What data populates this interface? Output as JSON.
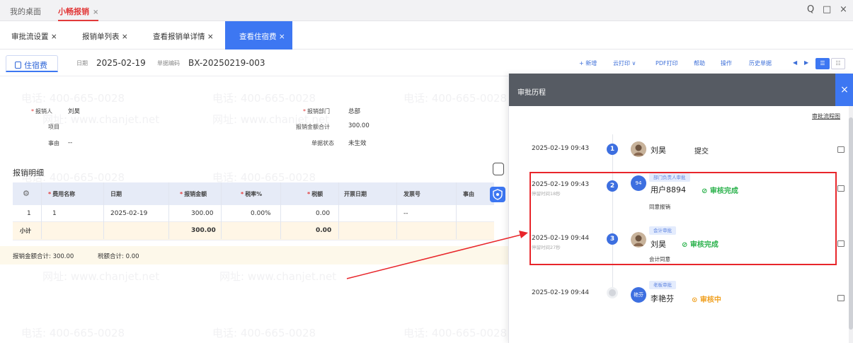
{
  "topbar": {
    "tabs": [
      {
        "label": "我的桌面"
      },
      {
        "label": "小畅报销",
        "close": "×"
      }
    ],
    "controls": {
      "search": "Q",
      "restore": "□",
      "close": "×"
    }
  },
  "subtabs": [
    {
      "label": "审批流设置",
      "close": "×"
    },
    {
      "label": "报销单列表",
      "close": "×"
    },
    {
      "label": "查看报销单详情",
      "close": "×"
    },
    {
      "label": "查看住宿费",
      "close": "×"
    }
  ],
  "doc": {
    "title": "住宿费",
    "date_label": "日期",
    "date": "2025-02-19",
    "number_label": "单据编码",
    "number": "BX-20250219-003"
  },
  "toolbar": [
    {
      "label": "+ 新增"
    },
    {
      "label": "云打印 ∨"
    },
    {
      "label": "PDF打印"
    },
    {
      "label": "帮助"
    },
    {
      "label": "操作"
    },
    {
      "label": "历史单据"
    }
  ],
  "form": {
    "applicant_label": "报销人",
    "applicant": "刘昊",
    "project_label": "项目",
    "reason_label": "事由",
    "reason": "--",
    "dept_label": "报销部门",
    "dept": "总部",
    "total_label": "报销金额合计",
    "total": "300.00",
    "status_label": "单据状态",
    "status": "未生效"
  },
  "details": {
    "section_title": "报销明细",
    "headers": [
      "费用名称",
      "日期",
      "报销金额",
      "税率%",
      "税额",
      "开票日期",
      "发票号",
      "事由"
    ],
    "rows": [
      {
        "no": "1",
        "name": "1",
        "date": "2025-02-19",
        "amount": "300.00",
        "rate": "0.00%",
        "tax": "0.00",
        "invoice_date": "",
        "invoice_no": "--",
        "reason": ""
      }
    ],
    "subtotal_label": "小计",
    "subtotal_amount": "300.00",
    "subtotal_tax": "0.00"
  },
  "footer": {
    "amount_label": "报销金额合计:",
    "amount": "300.00",
    "tax_label": "税额合计:",
    "tax": "0.00"
  },
  "panel": {
    "title": "审批历程",
    "close": "×",
    "link": "审批流程图",
    "entries": [
      {
        "step": "1",
        "time": "2025-02-19 09:43",
        "sub": "",
        "avatar": "photo",
        "badge": "",
        "name": "刘昊",
        "action": "提交",
        "status": "",
        "comment": ""
      },
      {
        "step": "2",
        "time": "2025-02-19 09:43",
        "sub": "停留时间18秒",
        "avatar": "94",
        "badge": "部门负责人审批",
        "name": "用户8894",
        "action": "",
        "status": "⊘ 审核完成",
        "comment": "同意报销"
      },
      {
        "step": "3",
        "time": "2025-02-19 09:44",
        "sub": "停留时间27秒",
        "avatar": "photo",
        "badge": "会计审批",
        "name": "刘昊",
        "action": "",
        "status": "⊘ 审核完成",
        "comment": "会计同意"
      },
      {
        "step": "",
        "time": "2025-02-19 09:44",
        "sub": "",
        "avatar": "艳芬",
        "badge": "老板审批",
        "name": "李艳芬",
        "action": "",
        "status": "⊙ 审核中",
        "comment": ""
      }
    ]
  },
  "watermark": {
    "phone": "电话: 400-665-0028",
    "site": "网址: www.chanjet.net"
  },
  "colors": {
    "accent": "#3d77f2",
    "danger": "#e23a3a",
    "success": "#2bb24c",
    "pending": "#f0a020",
    "panel_header": "#565b63"
  }
}
